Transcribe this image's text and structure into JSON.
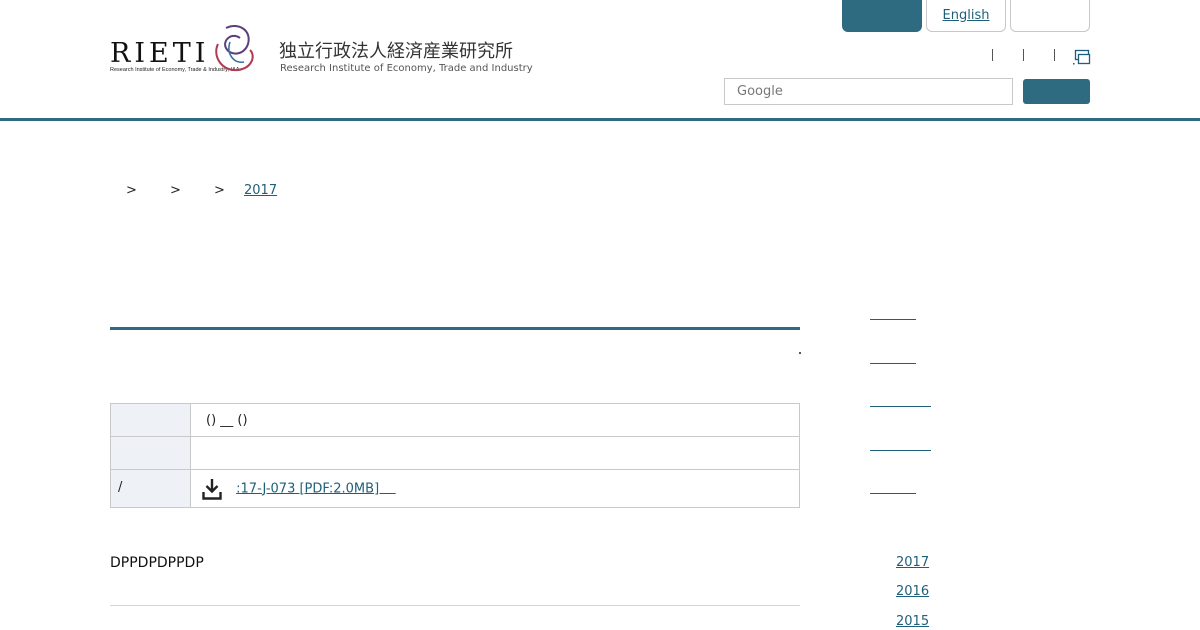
{
  "header": {
    "logo_text": "RIETI",
    "logo_subtitle": "Research Institute of Economy, Trade & Industry, IAA",
    "org_name_ja": "独立行政法人経済産業研究所",
    "org_name_en": "Research Institute of Economy, Trade and Industry",
    "top_buttons": {
      "primary_label": "",
      "english_label": "English",
      "third_label": ""
    },
    "search": {
      "placeholder": "Google",
      "value": "",
      "button_label": ""
    },
    "utility_icon": "window-icon",
    "accent_color": "#2e6b80"
  },
  "breadcrumb": {
    "items": [
      {
        "label": ""
      },
      {
        "label": ""
      },
      {
        "label": ""
      },
      {
        "label": "2017"
      }
    ],
    "separator": ">"
  },
  "main": {
    "title": "",
    "table": [
      {
        "header": "",
        "value": "()                 __ ()"
      },
      {
        "header": "",
        "value": ""
      },
      {
        "header": "/",
        "value": "",
        "icon": "download-icon",
        "link_label": ":17-J-073 [PDF:2.0MB]    "
      }
    ],
    "abstract_text": "DPPDPDPPDP"
  },
  "sidebar": {
    "links": [
      "",
      "",
      "",
      "",
      ""
    ],
    "years": [
      "2017",
      "2016",
      "2015"
    ]
  }
}
